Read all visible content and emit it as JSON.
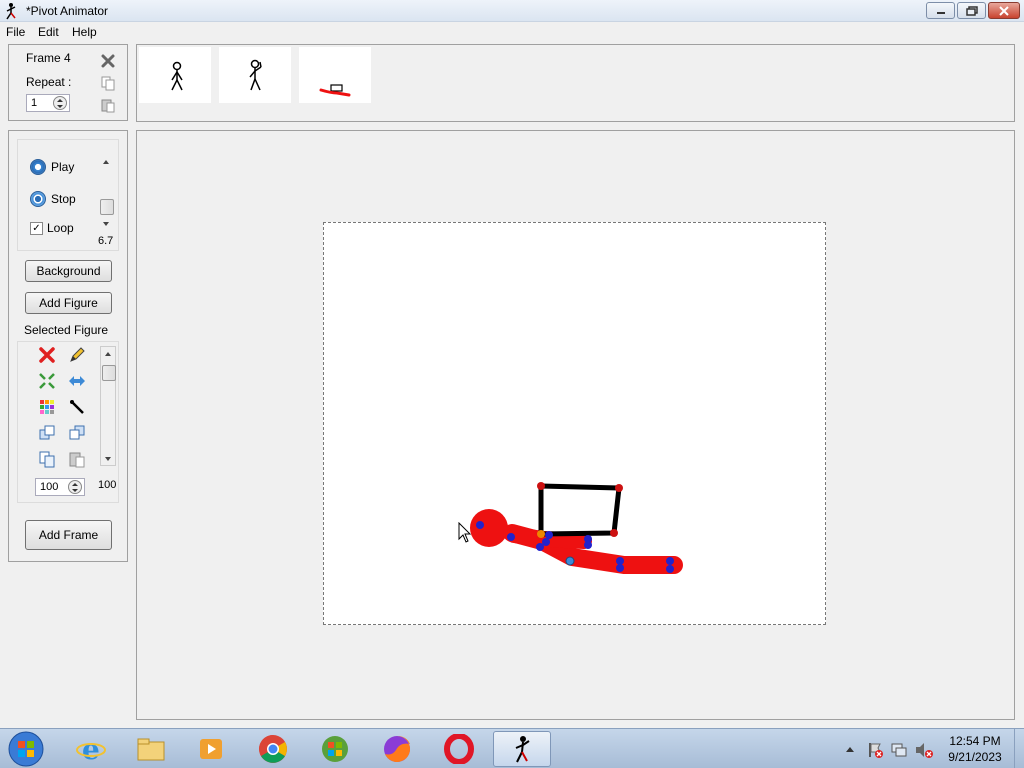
{
  "window": {
    "title": "*Pivot Animator",
    "minimize_icon": "minimize-icon",
    "maximize_icon": "restore-icon",
    "close_icon": "close-icon"
  },
  "menu": {
    "file": "File",
    "edit": "Edit",
    "help": "Help"
  },
  "frame_panel": {
    "frame_label": "Frame 4",
    "repeat_label": "Repeat :",
    "repeat_value": "1"
  },
  "playback": {
    "play_label": "Play",
    "stop_label": "Stop",
    "loop_label": "Loop",
    "loop_checked": true,
    "speed_value": "6.7"
  },
  "buttons": {
    "background": "Background",
    "add_figure": "Add Figure",
    "add_frame": "Add Frame"
  },
  "selected_figure": {
    "label": "Selected Figure",
    "scale_value": "100",
    "scale_readout": "100"
  },
  "taskbar": {
    "time": "12:54 PM",
    "date": "9/21/2023"
  },
  "colors": {
    "figure_red": "#ee1111",
    "joint_blue": "#2222cc",
    "joint_red": "#cc1111",
    "joint_orange": "#ee8800"
  }
}
